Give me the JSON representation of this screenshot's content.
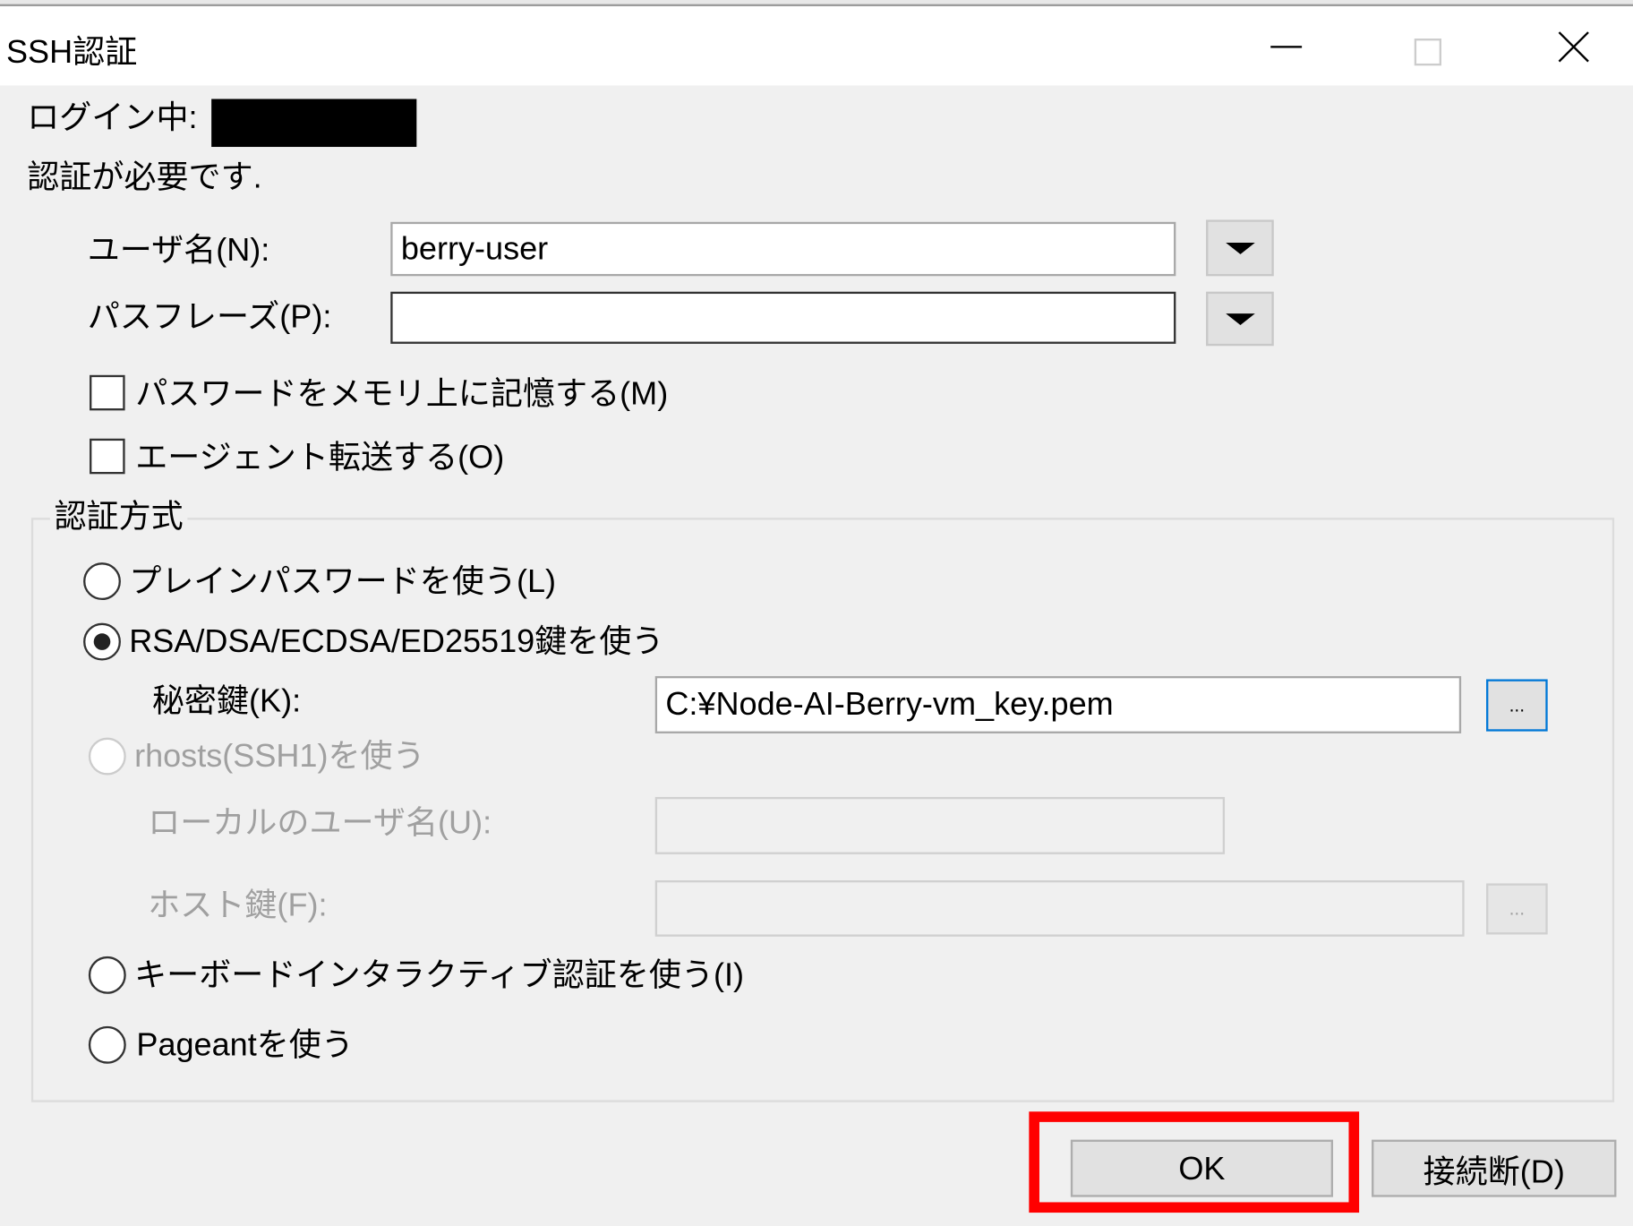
{
  "window": {
    "title": "SSH認証",
    "minimize_label": "—",
    "close_label": "✕"
  },
  "login": {
    "label": "ログイン中:",
    "value_redacted": true
  },
  "message": "認証が必要です.",
  "username": {
    "label": "ユーザ名(N):",
    "value": "berry-user"
  },
  "passphrase": {
    "label": "パスフレーズ(P):",
    "value": ""
  },
  "options": [
    {
      "label": "パスワードをメモリ上に記憶する(M)",
      "checked": false
    },
    {
      "label": "エージェント転送する(O)",
      "checked": false
    }
  ],
  "auth_method": {
    "legend": "認証方式",
    "plain_password": "プレインパスワードを使う(L)",
    "key": "RSA/DSA/ECDSA/ED25519鍵を使う",
    "private_key_label": "秘密鍵(K):",
    "private_key_value": "C:¥Node-AI-Berry-vm_key.pem",
    "browse_label": "...",
    "rhosts": "rhosts(SSH1)を使う",
    "local_user_label": "ローカルのユーザ名(U):",
    "host_key_label": "ホスト鍵(F):",
    "keyboard_interactive": "キーボードインタラクティブ認証を使う(I)",
    "pageant": "Pageantを使う",
    "selected": "key"
  },
  "buttons": {
    "ok": "OK",
    "disconnect": "接続断(D)"
  },
  "colors": {
    "highlight": "#ff0000",
    "focus_blue": "#0078d7"
  }
}
